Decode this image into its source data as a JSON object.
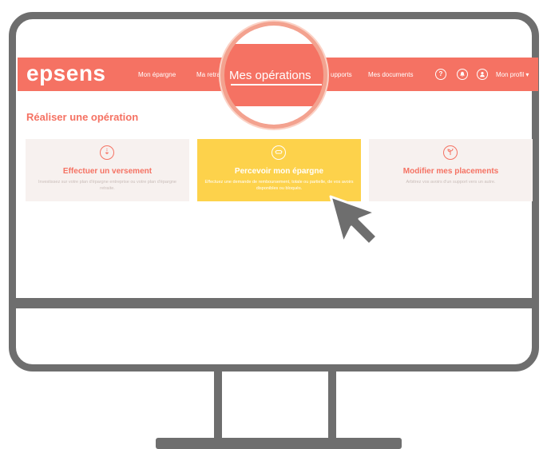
{
  "app": {
    "logo": "epsens"
  },
  "nav": {
    "items": [
      {
        "label": "Mon épargne"
      },
      {
        "label": "Ma retra"
      },
      {
        "label": "upports"
      },
      {
        "label": "Mes documents"
      }
    ],
    "help_icon": "question-icon",
    "notifications_icon": "bell-icon",
    "user_icon": "user-icon",
    "profile_label": "Mon profil",
    "profile_caret": "chevron-down-icon"
  },
  "magnifier": {
    "label": "Mes opérations"
  },
  "page": {
    "title": "Réaliser une opération"
  },
  "cards": [
    {
      "icon": "download-icon",
      "title": "Effectuer un versement",
      "description": "Investissez sur votre plan d'épargne entreprise ou votre plan d'épargne retraite."
    },
    {
      "icon": "savings-icon",
      "title": "Percevoir mon épargne",
      "description": "Effectuez une demande de remboursement, totale ou partielle, de vos avoirs disponibles ou bloqués."
    },
    {
      "icon": "plant-icon",
      "title": "Modifier mes placements",
      "description": "Arbitrez vos avoirs d'un support vers un autre."
    }
  ],
  "colors": {
    "brand": "#f57263",
    "highlight": "#fdd24b",
    "frame": "#6e6e6e"
  }
}
